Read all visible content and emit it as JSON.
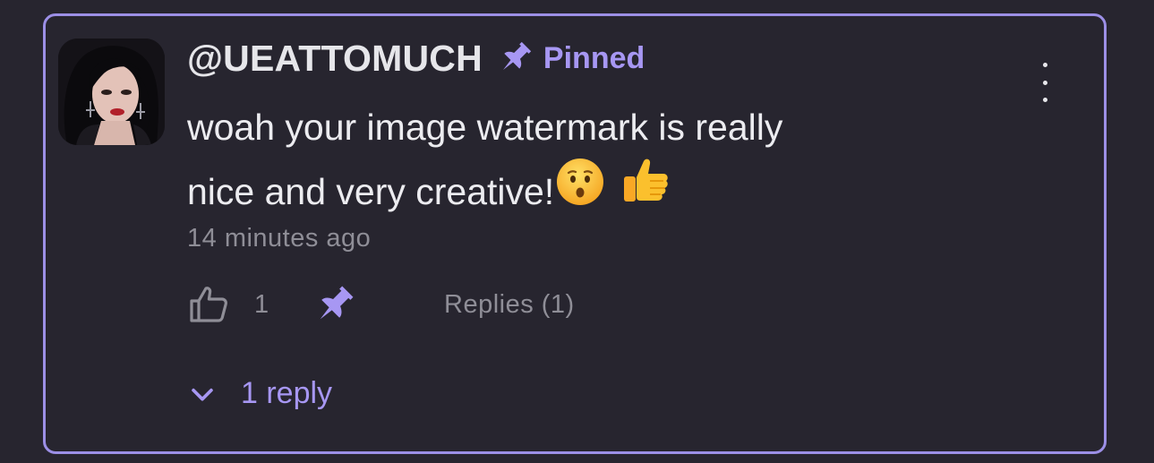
{
  "comment": {
    "username": "@UEATTOMUCH",
    "pinned_label": "Pinned",
    "text_line1": "woah your image watermark is really",
    "text_line2": "nice and very creative!",
    "emojis": [
      "hushed-face",
      "thumbs-up"
    ],
    "timestamp": "14 minutes ago",
    "like_count": "1",
    "replies_label": "Replies (1)",
    "reply_toggle_label": "1 reply"
  },
  "icons": {
    "pin": "pin-icon",
    "like": "thumbs-up-outline-icon",
    "menu": "more-vertical-icon",
    "chevron": "chevron-down-icon"
  },
  "colors": {
    "background": "#27252f",
    "accent": "#a797f3",
    "border": "#9c8fe6",
    "text": "#ececf0",
    "muted": "#8f8e97"
  }
}
